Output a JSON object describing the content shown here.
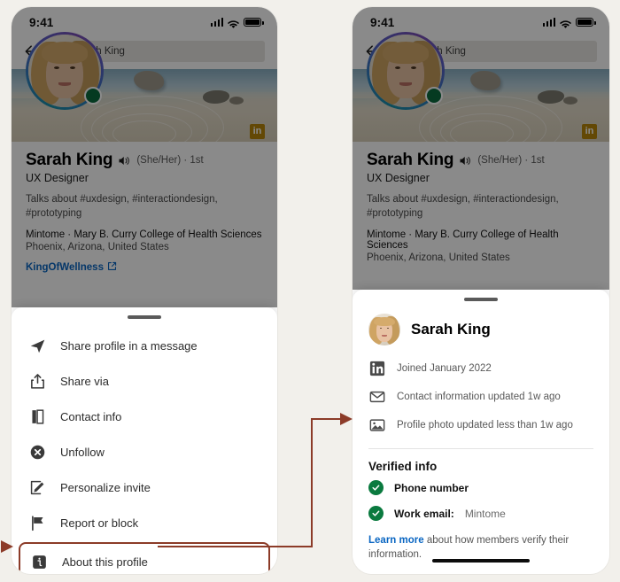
{
  "meta": {
    "background_color": "#f2f0eb",
    "accent_color": "#8c3b28",
    "link_color": "#0a66c2",
    "verified_green": "#0a7a3f",
    "linkedin_gold": "#b8860b"
  },
  "status_bar": {
    "time": "9:41",
    "icons": [
      "cellular-signal-icon",
      "wifi-icon",
      "battery-icon"
    ]
  },
  "search": {
    "back_icon": "back-arrow-icon",
    "search_icon": "search-icon",
    "value": "Sarah King"
  },
  "profile": {
    "name": "Sarah King",
    "speaker_icon": "name-pronunciation-icon",
    "pronouns_degree": "(She/Her) · 1st",
    "headline": "UX Designer",
    "talks_about": "Talks about #uxdesign, #interactiondesign, #prototyping",
    "company_school": "Mintome · Mary B. Curry College of Health Sciences",
    "location": "Phoenix, Arizona, United States",
    "website": "KingOfWellness",
    "website_icon": "external-link-icon",
    "linkedin_badge": "in",
    "online_badge": "online-status-icon"
  },
  "left_sheet": {
    "grabber": "sheet-drag-handle",
    "menu": [
      {
        "icon": "send-icon",
        "label": "Share profile in a message"
      },
      {
        "icon": "share-upload-icon",
        "label": "Share via"
      },
      {
        "icon": "contact-card-icon",
        "label": "Contact info"
      },
      {
        "icon": "x-circle-icon",
        "label": "Unfollow"
      },
      {
        "icon": "pencil-square-icon",
        "label": "Personalize invite"
      },
      {
        "icon": "flag-icon",
        "label": "Report or block"
      },
      {
        "icon": "info-square-icon",
        "label": "About this profile",
        "highlighted": true
      }
    ]
  },
  "right_sheet": {
    "grabber": "sheet-drag-handle",
    "name": "Sarah King",
    "rows": [
      {
        "icon": "linkedin-icon",
        "text": "Joined January 2022"
      },
      {
        "icon": "envelope-icon",
        "text": "Contact information updated 1w ago"
      },
      {
        "icon": "photo-icon",
        "text": "Profile photo updated less than 1w ago"
      }
    ],
    "verified_title": "Verified info",
    "verified": [
      {
        "icon": "check-circle-icon",
        "label": "Phone number",
        "value": ""
      },
      {
        "icon": "check-circle-icon",
        "label": "Work email:",
        "value": "Mintome"
      }
    ],
    "learn_more_link": "Learn more",
    "learn_more_rest": " about how members verify their information."
  },
  "annotation": {
    "arrow_name": "flow-arrow-about-this-profile-to-detail-panel",
    "color": "#8c3b28"
  }
}
